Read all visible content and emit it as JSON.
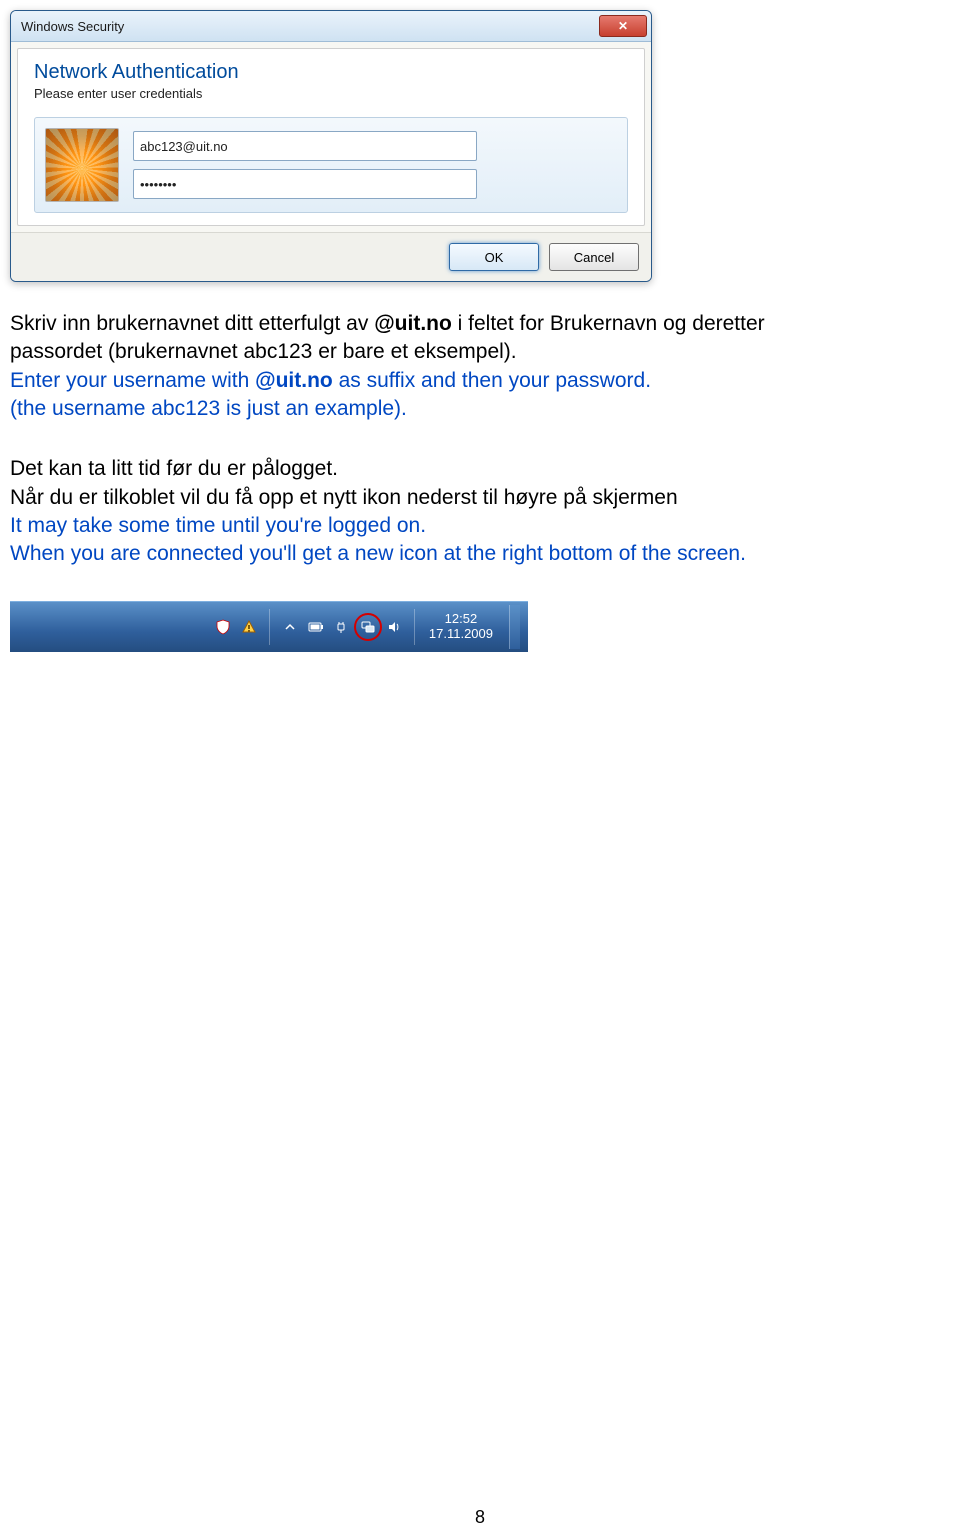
{
  "dialog": {
    "title": "Windows Security",
    "heading": "Network Authentication",
    "subtext": "Please enter user credentials",
    "username_value": "abc123@uit.no",
    "password_value": "••••••••",
    "ok_label": "OK",
    "cancel_label": "Cancel"
  },
  "instructions": {
    "p1_l1_a": "Skriv inn brukernavnet ditt etterfulgt av ",
    "p1_l1_b": "@uit.no",
    "p1_l1_c": " i feltet for Brukernavn og deretter",
    "p1_l2": "passordet (brukernavnet abc123 er bare et eksempel).",
    "p1_l3_a": "Enter your username with ",
    "p1_l3_b": "@uit.no",
    "p1_l3_c": " as suffix and then your password.",
    "p1_l4": " (the username abc123 is just an example).",
    "p2_l1": "Det kan ta litt tid før du er pålogget.",
    "p2_l2": "Når du er tilkoblet vil du få opp et nytt ikon nederst til høyre på skjermen",
    "p2_l3": "It may take some time until you're logged on.",
    "p2_l4": "When you are connected you'll get a new icon at the right bottom of the screen."
  },
  "tray": {
    "time": "12:52",
    "date": "17.11.2009"
  },
  "page_number": "8"
}
